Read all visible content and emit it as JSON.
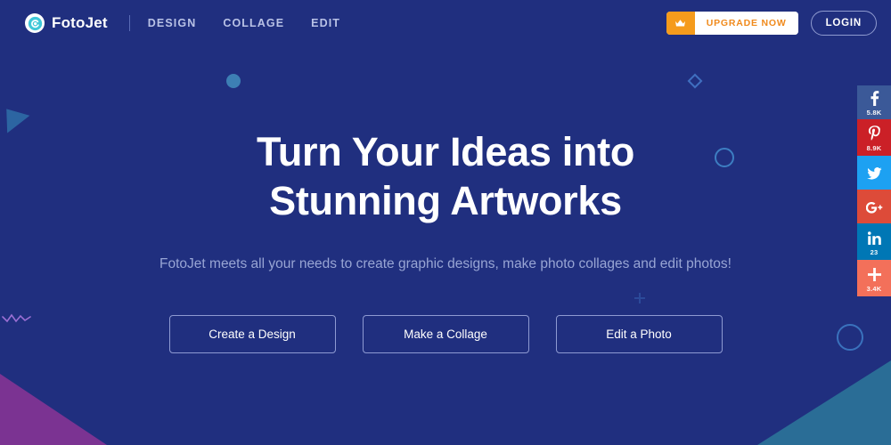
{
  "brand": {
    "name": "FotoJet",
    "logo_icon": "fotojet-spiral-icon"
  },
  "nav": {
    "items": [
      {
        "label": "DESIGN"
      },
      {
        "label": "COLLAGE"
      },
      {
        "label": "EDIT"
      }
    ]
  },
  "header_actions": {
    "upgrade_label": "UPGRADE NOW",
    "upgrade_icon": "crown-icon",
    "login_label": "LOGIN"
  },
  "hero": {
    "title_line1": "Turn Your Ideas into",
    "title_line2": "Stunning Artworks",
    "subtitle": "FotoJet meets all your needs to create graphic designs, make photo collages and edit photos!",
    "buttons": [
      {
        "label": "Create a Design"
      },
      {
        "label": "Make a Collage"
      },
      {
        "label": "Edit a Photo"
      }
    ]
  },
  "social_rail": {
    "items": [
      {
        "network": "facebook",
        "icon": "facebook-icon",
        "glyph": "f",
        "count": "5.8K",
        "color": "#3b5998"
      },
      {
        "network": "pinterest",
        "icon": "pinterest-icon",
        "glyph": "P",
        "count": "8.9K",
        "color": "#cb2027"
      },
      {
        "network": "twitter",
        "icon": "twitter-icon",
        "glyph": "ᵗ",
        "count": "",
        "color": "#1da1f2"
      },
      {
        "network": "googleplus",
        "icon": "google-plus-icon",
        "glyph": "G+",
        "count": "",
        "color": "#dd4b39"
      },
      {
        "network": "linkedin",
        "icon": "linkedin-icon",
        "glyph": "in",
        "count": "23",
        "color": "#0077b5"
      },
      {
        "network": "share",
        "icon": "plus-share-icon",
        "glyph": "+",
        "count": "3.4K",
        "color": "#f3705a"
      }
    ]
  },
  "colors": {
    "background": "#202f7f",
    "accent_orange": "#f59b1c",
    "subtitle_text": "#98a5d4",
    "corner_purple": "#7b3392",
    "corner_teal": "#2a6d96"
  }
}
